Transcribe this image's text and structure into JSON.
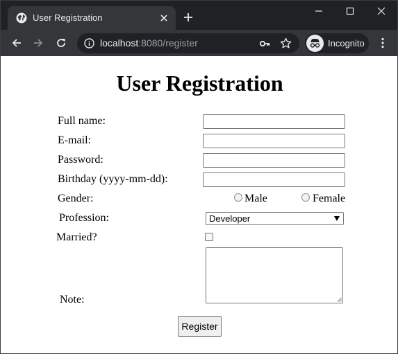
{
  "browser": {
    "tab": {
      "title": "User Registration"
    },
    "address_bar": {
      "host": "localhost",
      "path": ":8080/register"
    },
    "incognito_label": "Incognito"
  },
  "page": {
    "title": "User Registration",
    "form": {
      "full_name": {
        "label": "Full name:",
        "value": ""
      },
      "email": {
        "label": "E-mail:",
        "value": ""
      },
      "password": {
        "label": "Password:",
        "value": ""
      },
      "birthday": {
        "label": "Birthday (yyyy-mm-dd):",
        "value": ""
      },
      "gender": {
        "label": "Gender:",
        "options": [
          {
            "label": "Male",
            "checked": false
          },
          {
            "label": "Female",
            "checked": false
          }
        ]
      },
      "profession": {
        "label": "Profession:",
        "selected": "Developer"
      },
      "married": {
        "label": "Married?",
        "checked": false
      },
      "note": {
        "label": "Note:",
        "value": ""
      },
      "submit_label": "Register"
    }
  },
  "colors": {
    "chrome_dark": "#202124",
    "chrome_tab": "#35363a",
    "chrome_text": "#e8eaed"
  }
}
